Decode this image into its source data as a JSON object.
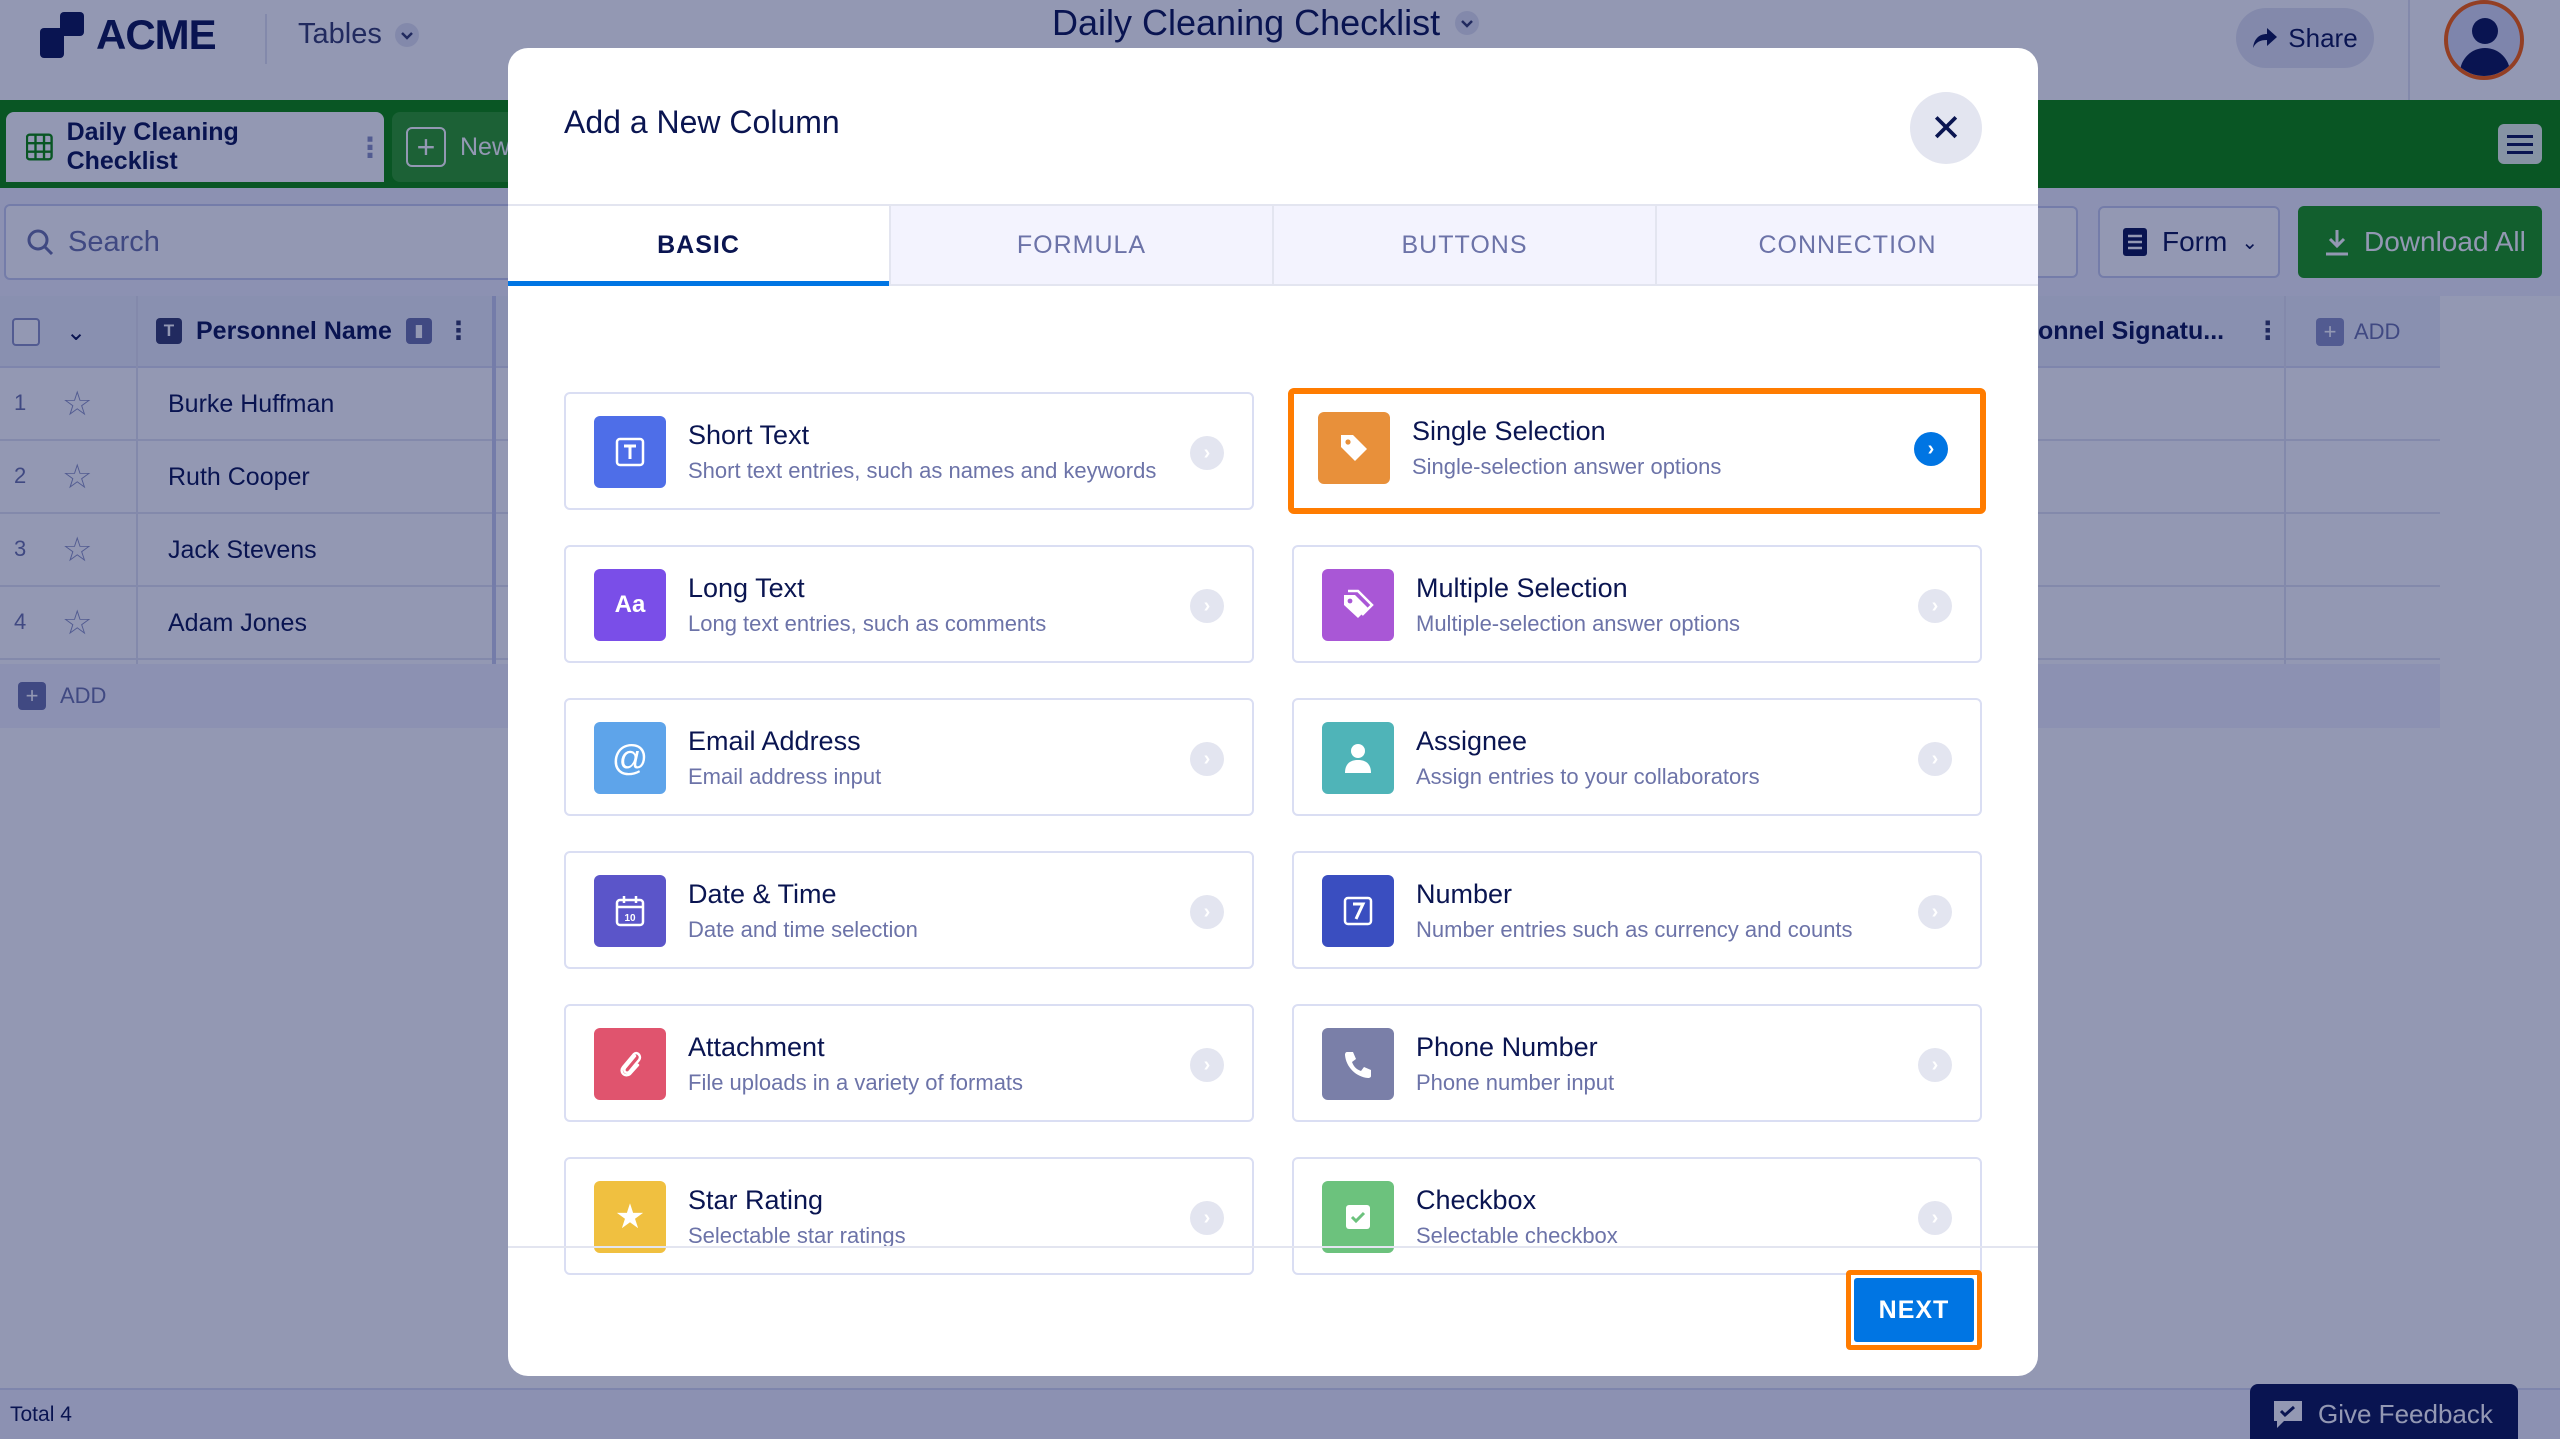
{
  "app": {
    "logo_text": "ACME",
    "tables_menu": "Tables",
    "doc_title": "Daily Cleaning Checklist",
    "share_label": "Share"
  },
  "sheet_tabs": {
    "active": "Daily Cleaning Checklist",
    "new_partial": "New"
  },
  "toolbar": {
    "search_placeholder": "Search",
    "form_label": "Form",
    "download_label": "Download All"
  },
  "table": {
    "col_name": "Personnel Name",
    "col_signature": "onnel Signatu...",
    "add_column": "ADD",
    "rows": [
      {
        "num": "1",
        "name": "Burke Huffman"
      },
      {
        "num": "2",
        "name": "Ruth Cooper"
      },
      {
        "num": "3",
        "name": "Jack Stevens"
      },
      {
        "num": "4",
        "name": "Adam Jones"
      }
    ],
    "add_row": "ADD",
    "total": "Total 4"
  },
  "feedback_label": "Give Feedback",
  "modal": {
    "title": "Add a New Column",
    "tabs": [
      "BASIC",
      "FORMULA",
      "BUTTONS",
      "CONNECTION"
    ],
    "active_tab": "BASIC",
    "options": [
      {
        "title": "Short Text",
        "desc": "Short text entries, such as names and keywords",
        "icon": "text-icon",
        "color": "#4e6ee8",
        "glyph": "T"
      },
      {
        "title": "Single Selection",
        "desc": "Single-selection answer options",
        "icon": "tag-icon",
        "color": "#e8903a",
        "glyph": "",
        "selected": true
      },
      {
        "title": "Long Text",
        "desc": "Long text entries, such as comments",
        "icon": "long-text-icon",
        "color": "#7a4ee8",
        "glyph": "Aa"
      },
      {
        "title": "Multiple Selection",
        "desc": "Multiple-selection answer options",
        "icon": "tags-icon",
        "color": "#a957d6",
        "glyph": ""
      },
      {
        "title": "Email Address",
        "desc": "Email address input",
        "icon": "at-icon",
        "color": "#5ea4ea",
        "glyph": "@"
      },
      {
        "title": "Assignee",
        "desc": "Assign entries to your collaborators",
        "icon": "person-icon",
        "color": "#4fb4b8",
        "glyph": ""
      },
      {
        "title": "Date & Time",
        "desc": "Date and time selection",
        "icon": "calendar-icon",
        "color": "#5b55c9",
        "glyph": ""
      },
      {
        "title": "Number",
        "desc": "Number entries such as currency and counts",
        "icon": "number-icon",
        "color": "#3a4ec0",
        "glyph": "7"
      },
      {
        "title": "Attachment",
        "desc": "File uploads in a variety of formats",
        "icon": "paperclip-icon",
        "color": "#e0546e",
        "glyph": ""
      },
      {
        "title": "Phone Number",
        "desc": "Phone number input",
        "icon": "phone-icon",
        "color": "#7a7fa8",
        "glyph": ""
      },
      {
        "title": "Star Rating",
        "desc": "Selectable star ratings",
        "icon": "star-icon",
        "color": "#f0c040",
        "glyph": "★"
      },
      {
        "title": "Checkbox",
        "desc": "Selectable checkbox",
        "icon": "checkbox-icon",
        "color": "#6cc27d",
        "glyph": ""
      }
    ],
    "next_label": "NEXT"
  }
}
